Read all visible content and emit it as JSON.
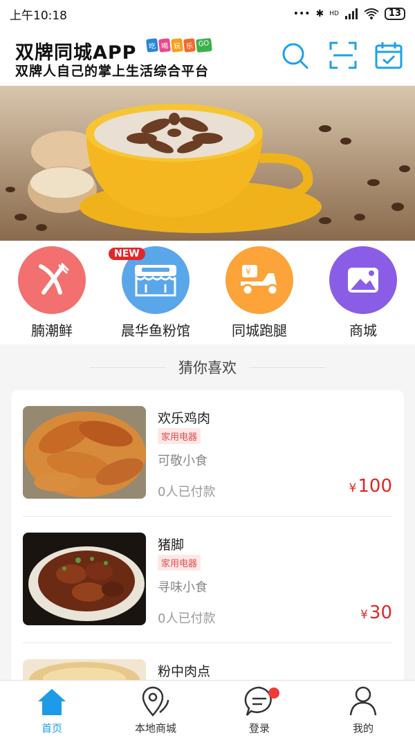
{
  "status_bar": {
    "time": "上午10:18",
    "signal": "HD",
    "battery": "13"
  },
  "header": {
    "title": "双牌同城APP",
    "tags": [
      "吃",
      "喝",
      "玩",
      "乐",
      "GO"
    ],
    "subtitle": "双牌人自己的掌上生活综合平台",
    "icons": [
      "search-icon",
      "scan-icon",
      "calendar-check-icon"
    ],
    "accent_color": "#1da1e6"
  },
  "categories": [
    {
      "label": "腩潮鲜",
      "color": "#f27070",
      "icon": "utensils-icon"
    },
    {
      "label": "晨华鱼粉馆",
      "color": "#5aa6ea",
      "icon": "store-icon",
      "badge": "NEW"
    },
    {
      "label": "同城跑腿",
      "color": "#fca33a",
      "icon": "delivery-scooter-icon"
    },
    {
      "label": "商城",
      "color": "#8a5de6",
      "icon": "mountain-icon"
    }
  ],
  "section": {
    "title": "猜你喜欢"
  },
  "products": [
    {
      "name": "欢乐鸡肉",
      "tag": "家用电器",
      "shop": "可敬小食",
      "paid": "0人已付款",
      "currency": "¥",
      "price": "100"
    },
    {
      "name": "猪脚",
      "tag": "家用电器",
      "shop": "寻味小食",
      "paid": "0人已付款",
      "currency": "¥",
      "price": "30"
    },
    {
      "name": "粉中肉点"
    }
  ],
  "tabbar": [
    {
      "label": "首页",
      "icon": "home-icon",
      "active": true
    },
    {
      "label": "本地商城",
      "icon": "map-pin-icon"
    },
    {
      "label": "登录",
      "icon": "chat-bubble-icon"
    },
    {
      "label": "我的",
      "icon": "user-icon"
    }
  ]
}
